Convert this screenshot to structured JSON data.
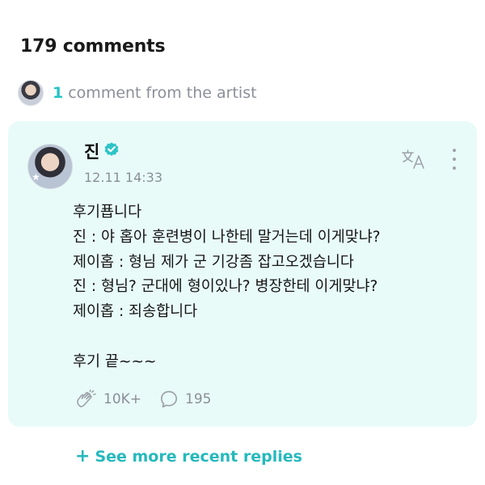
{
  "header": {
    "comments_count_text": "179 comments"
  },
  "artist_summary": {
    "count": "1",
    "text": "comment from the artist"
  },
  "comment": {
    "author": "진",
    "timestamp": "12.11 14:33",
    "body": "후기푭니다\n진 : 야 홉아 훈련병이 나한테 말거는데 이게맞냐?\n제이홉 : 형님 제가 군 기강좀 잡고오겠습니다\n진 : 형님? 군대에 형이있나? 병장한테 이게맞냐?\n제이홉 : 죄송합니다\n\n후기 끝~~~",
    "likes": "10K+",
    "replies": "195",
    "icons": {
      "verified": "verified-badge-icon",
      "translate": "translate-icon",
      "more": "more-vertical-icon",
      "like": "clap-icon",
      "reply": "speech-bubble-icon"
    }
  },
  "footer": {
    "see_more_plus": "+",
    "see_more_label": "See more recent replies"
  },
  "colors": {
    "accent": "#25c3c4",
    "card_bg": "#e8fbf8",
    "muted_text": "#8b8f98"
  }
}
